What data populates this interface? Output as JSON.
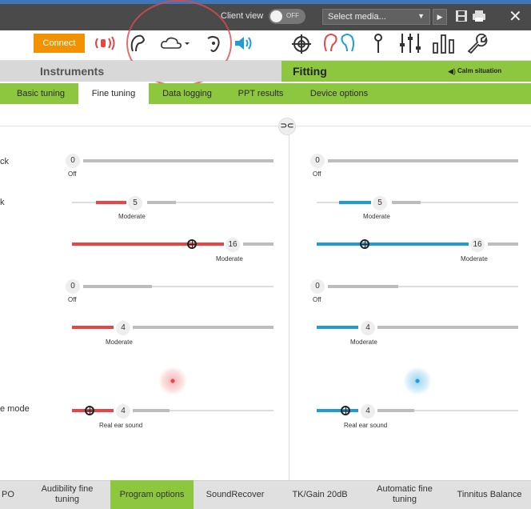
{
  "topbar": {
    "client_view_label": "Client view",
    "toggle_state": "OFF",
    "select_media": "Select media..."
  },
  "toolbar": {
    "connect_label": "Connect"
  },
  "tabs": {
    "instruments": "Instruments",
    "fitting": "Fitting",
    "calm_situation": "Calm situation"
  },
  "subtabs": [
    "Basic tuning",
    "Fine tuning",
    "Data logging",
    "PPT results",
    "Device options"
  ],
  "rows": {
    "labels": [
      "ck",
      "k",
      "",
      "",
      "",
      "e mode"
    ],
    "left": [
      {
        "value": "0",
        "sub": "Off"
      },
      {
        "value": "5",
        "sub": "Moderate"
      },
      {
        "value": "16",
        "sub": "Moderate"
      },
      {
        "value": "0",
        "sub": "Off"
      },
      {
        "value": "4",
        "sub": "Moderate"
      },
      {
        "value": "4",
        "sub": "Real ear sound"
      }
    ],
    "right": [
      {
        "value": "0",
        "sub": "Off"
      },
      {
        "value": "5",
        "sub": "Moderate"
      },
      {
        "value": "16",
        "sub": "Moderate"
      },
      {
        "value": "0",
        "sub": "Off"
      },
      {
        "value": "4",
        "sub": "Moderate"
      },
      {
        "value": "4",
        "sub": "Real ear sound"
      }
    ]
  },
  "link_symbol": "⊃⊂",
  "bottom_tabs": [
    "PO",
    "Audibility fine tuning",
    "Program options",
    "SoundRecover",
    "TK/Gain 20dB",
    "Automatic fine tuning",
    "Tinnitus Balance"
  ],
  "colors": {
    "accent_green": "#8dc63f",
    "left_red": "#e84545",
    "right_blue": "#1f9bd6",
    "connect_orange": "#f39200"
  }
}
